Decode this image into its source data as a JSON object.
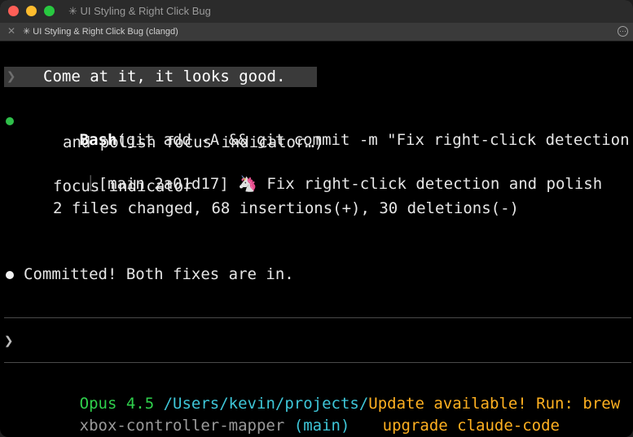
{
  "window": {
    "title": "✳ UI Styling & Right Click Bug"
  },
  "tab": {
    "title": "✳ UI Styling & Right Click Bug (clangd)",
    "close_glyph": "✕"
  },
  "terminal": {
    "prompt_glyph": "❯",
    "user_message": "Come at it, it looks good.",
    "tool_call": {
      "name": "Bash",
      "args_line1": "(git add -A && git commit -m \"Fix right-click detection",
      "args_line2": "and polish focus indicator…)",
      "result_prefix": "⎿",
      "result_line1": "[main 2a01d17] 🦄 Fix right-click detection and polish",
      "result_line2": "focus indicator",
      "result_line3": "2 files changed, 68 insertions(+), 30 deletions(-)"
    },
    "assistant_message": "Committed! Both fixes are in.",
    "input_glyph": "❯"
  },
  "statusline": {
    "model": "Opus 4.5",
    "path": "/Users/kevin/projects/",
    "project": "xbox-controller-mapper",
    "branch": "(main)",
    "update_line1": "Update available! Run: brew",
    "update_line2": "upgrade claude-code"
  },
  "colors": {
    "bullet_success": "#2fbf4a",
    "model": "#2fd04c",
    "path": "#3ec6d8",
    "update": "#ffb020"
  }
}
